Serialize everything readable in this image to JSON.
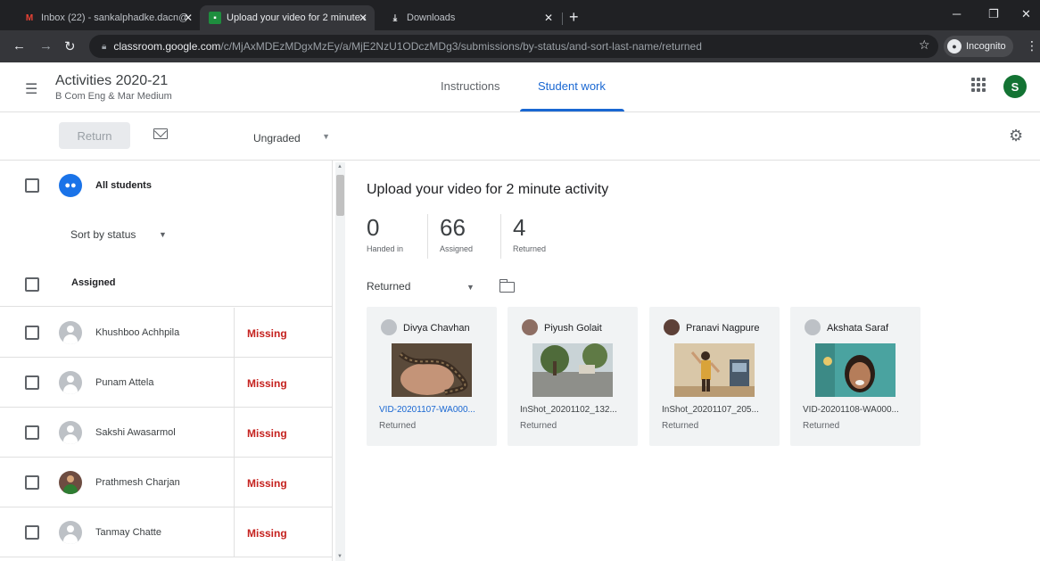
{
  "browser": {
    "tabs": [
      {
        "label": "Inbox (22) - sankalphadke.dacn@",
        "icon": "gmail-icon"
      },
      {
        "label": "Upload your video for 2 minute a",
        "icon": "classroom-icon"
      },
      {
        "label": "Downloads",
        "icon": "download-icon"
      }
    ],
    "url_host": "classroom.google.com",
    "url_path": "/c/MjAxMDEzMDgxMzEy/a/MjE2NzU1ODczMDg3/submissions/by-status/and-sort-last-name/returned",
    "incognito_label": "Incognito"
  },
  "header": {
    "class_title": "Activities 2020-21",
    "class_subtitle": "B Com Eng & Mar Medium",
    "tabs": [
      {
        "label": "Instructions"
      },
      {
        "label": "Student work"
      }
    ],
    "account_initial": "S",
    "accent": "#1967d2"
  },
  "actions": {
    "return_label": "Return",
    "grade_filter": "Ungraded"
  },
  "roster": {
    "all_students_label": "All students",
    "sort_label": "Sort by status",
    "group_label": "Assigned",
    "students": [
      {
        "name": "Khushboo Achhpila",
        "status": "Missing",
        "photo": false
      },
      {
        "name": "Punam Attela",
        "status": "Missing",
        "photo": false
      },
      {
        "name": "Sakshi Awasarmol",
        "status": "Missing",
        "photo": false
      },
      {
        "name": "Prathmesh Charjan",
        "status": "Missing",
        "photo": true
      },
      {
        "name": "Tanmay Chatte",
        "status": "Missing",
        "photo": false
      }
    ],
    "status_color": "#c5221f"
  },
  "assignment": {
    "title": "Upload your video for 2 minute activity",
    "stats": [
      {
        "value": "0",
        "label": "Handed in"
      },
      {
        "value": "66",
        "label": "Assigned"
      },
      {
        "value": "4",
        "label": "Returned"
      }
    ],
    "filter": "Returned",
    "submissions": [
      {
        "student": "Divya Chavhan",
        "file": "VID-20201107-WA000...",
        "status": "Returned"
      },
      {
        "student": "Piyush Golait",
        "file": "InShot_20201102_132...",
        "status": "Returned"
      },
      {
        "student": "Pranavi Nagpure",
        "file": "InShot_20201107_205...",
        "status": "Returned"
      },
      {
        "student": "Akshata Saraf",
        "file": "VID-20201108-WA000...",
        "status": "Returned"
      }
    ]
  }
}
